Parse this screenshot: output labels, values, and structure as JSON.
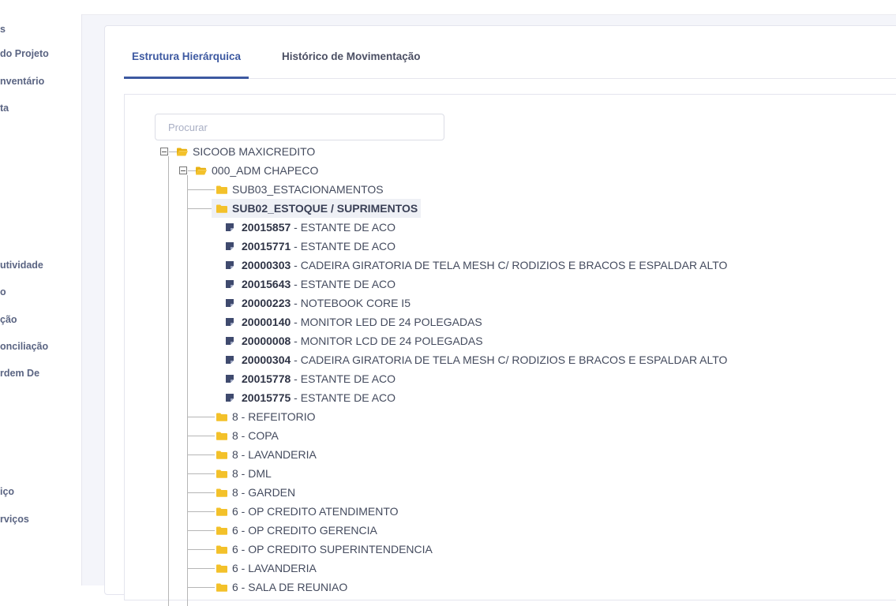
{
  "sidebar": {
    "items": [
      {
        "label": "s"
      },
      {
        "label": "do Projeto"
      },
      {
        "label": "nventário"
      },
      {
        "label": "ta"
      },
      {
        "label": "utividade"
      },
      {
        "label": "o"
      },
      {
        "label": "ção"
      },
      {
        "label": "onciliação"
      },
      {
        "label": "rdem De"
      },
      {
        "label": "iço"
      },
      {
        "label": "rviços"
      }
    ]
  },
  "tabs": [
    {
      "label": "Estrutura Hierárquica",
      "active": true
    },
    {
      "label": "Histórico de Movimentação",
      "active": false
    }
  ],
  "search": {
    "placeholder": "Procurar",
    "value": ""
  },
  "tree": {
    "root": {
      "label": "SICOOB MAXICREDITO",
      "icon": "folder-open-icon"
    },
    "branch": {
      "label": "000_ADM CHAPECO",
      "icon": "folder-open-icon"
    },
    "sub1": {
      "label": "SUB03_ESTACIONAMENTOS",
      "icon": "folder-icon"
    },
    "sub2": {
      "label": "SUB02_ESTOQUE / SUPRIMENTOS",
      "icon": "folder-icon",
      "selected": true
    },
    "assets": [
      {
        "code": "20015857",
        "desc": " - ESTANTE DE ACO"
      },
      {
        "code": "20015771",
        "desc": " - ESTANTE DE ACO"
      },
      {
        "code": "20000303",
        "desc": " - CADEIRA GIRATORIA DE TELA MESH C/ RODIZIOS E BRACOS E ESPALDAR ALTO"
      },
      {
        "code": "20015643",
        "desc": " - ESTANTE DE ACO"
      },
      {
        "code": "20000223",
        "desc": " - NOTEBOOK CORE I5"
      },
      {
        "code": "20000140",
        "desc": " - MONITOR LED DE 24 POLEGADAS"
      },
      {
        "code": "20000008",
        "desc": " - MONITOR LCD DE 24 POLEGADAS"
      },
      {
        "code": "20000304",
        "desc": " - CADEIRA GIRATORIA DE TELA MESH C/ RODIZIOS E BRACOS E ESPALDAR ALTO"
      },
      {
        "code": "20015778",
        "desc": " - ESTANTE DE ACO"
      },
      {
        "code": "20015775",
        "desc": " - ESTANTE DE ACO"
      }
    ],
    "folders": [
      {
        "label": "8 - REFEITORIO"
      },
      {
        "label": "8 - COPA"
      },
      {
        "label": "8 - LAVANDERIA"
      },
      {
        "label": "8 - DML"
      },
      {
        "label": "8 - GARDEN"
      },
      {
        "label": "6 - OP CREDITO ATENDIMENTO"
      },
      {
        "label": "6 - OP CREDITO GERENCIA"
      },
      {
        "label": "6 - OP CREDITO SUPERINTENDENCIA"
      },
      {
        "label": "6 - LAVANDERIA"
      },
      {
        "label": "6 - SALA DE REUNIAO"
      }
    ]
  },
  "colors": {
    "accent": "#3d59a1",
    "folder": "#f3c12a",
    "asset_icon": "#3f4a6e",
    "sidebar_text": "#5a6482"
  }
}
